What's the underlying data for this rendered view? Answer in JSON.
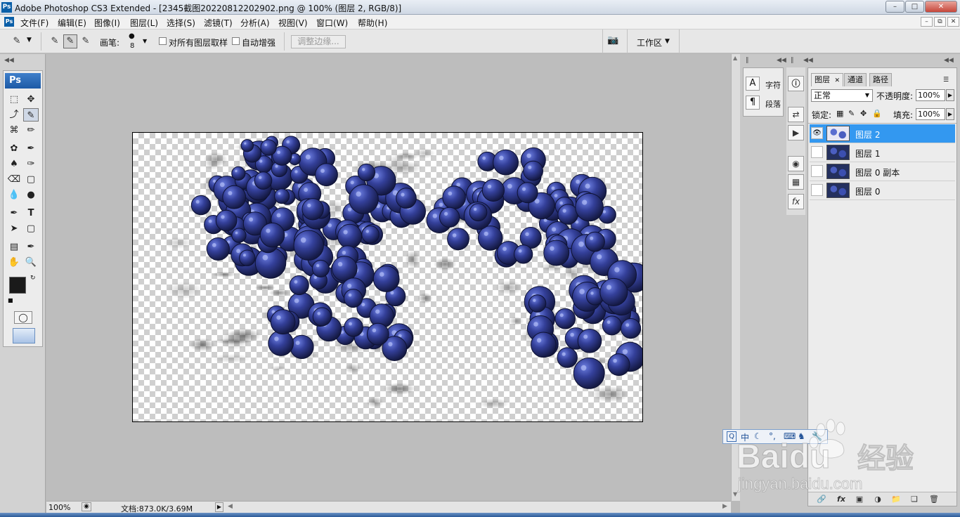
{
  "window": {
    "title": "Adobe Photoshop CS3 Extended - [2345截图20220812202902.png @ 100% (图层 2, RGB/8)]",
    "app_icon": "Ps"
  },
  "menu": {
    "items": [
      "文件(F)",
      "编辑(E)",
      "图像(I)",
      "图层(L)",
      "选择(S)",
      "滤镜(T)",
      "分析(A)",
      "视图(V)",
      "窗口(W)",
      "帮助(H)"
    ]
  },
  "options_bar": {
    "brush_label": "画笔:",
    "brush_size": "8",
    "sample_all_layers": "对所有图层取样",
    "auto_enhance": "自动增强",
    "refine_edge": "调整边缘...",
    "workspace": "工作区"
  },
  "toolbox": {
    "logo": "Ps"
  },
  "status_bar": {
    "zoom": "100%",
    "doc_info": "文档:873.0K/3.69M"
  },
  "character_panel": {
    "char_label": "字符",
    "para_label": "段落"
  },
  "layers_panel": {
    "tabs": [
      "图层",
      "通道",
      "路径"
    ],
    "blend_mode": "正常",
    "opacity_label": "不透明度:",
    "opacity_value": "100%",
    "lock_label": "锁定:",
    "fill_label": "填充:",
    "fill_value": "100%",
    "layers": [
      {
        "name": "图层 2",
        "selected": true,
        "visible": true
      },
      {
        "name": "图层 1",
        "selected": false,
        "visible": false
      },
      {
        "name": "图层 0 副本",
        "selected": false,
        "visible": false
      },
      {
        "name": "图层 0",
        "selected": false,
        "visible": false
      }
    ]
  },
  "ime_bar": {
    "mode": "中"
  },
  "watermark": {
    "brand": "Baidu",
    "brand_cn": "经验",
    "url": "jingyan.baidu.com"
  }
}
